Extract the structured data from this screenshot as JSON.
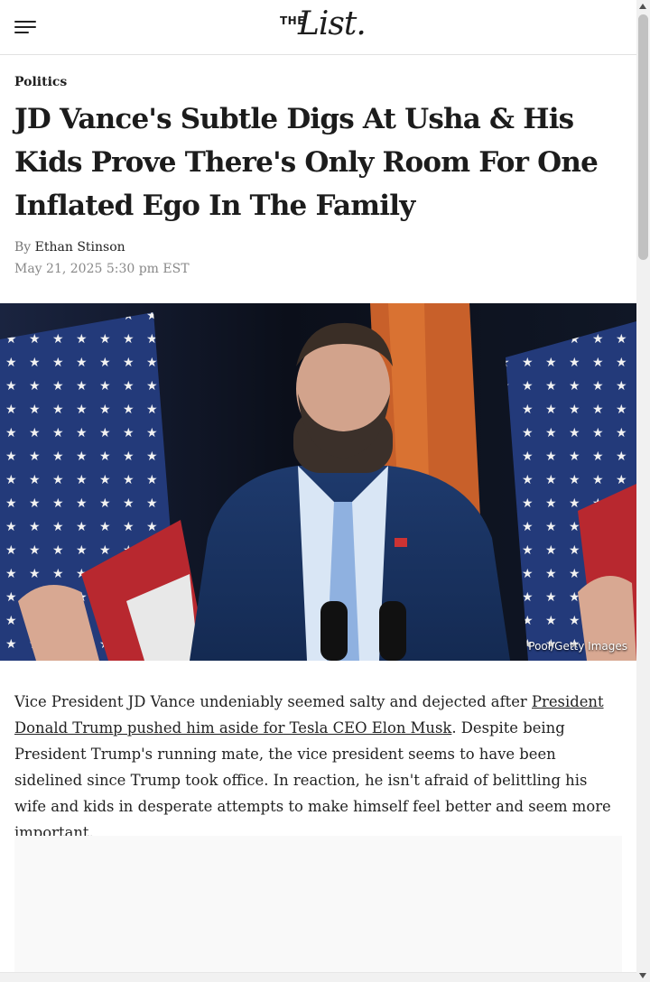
{
  "header": {
    "logo_the": "THE",
    "logo_list": "List."
  },
  "article": {
    "category": "Politics",
    "title": "JD Vance's Subtle Digs At Usha & His Kids Prove There's Only Room For One Inflated Ego In The Family",
    "byline_prefix": "By",
    "author": "Ethan Stinson",
    "date": "May 21, 2025 5:30 pm EST",
    "image_credit": "Pool/Getty Images",
    "paragraph_1_start": "Vice President JD Vance undeniably seemed salty and dejected after ",
    "paragraph_1_link": "President Donald Trump pushed him aside for Tesla CEO Elon Musk",
    "paragraph_1_end": ". Despite being President Trump's running mate, the vice president seems to have been sidelined since Trump took office. In reaction, he isn't afraid of belittling his wife and kids in desperate attempts to make himself feel better and seem more important."
  },
  "icons": {
    "menu": "hamburger-menu-icon"
  }
}
